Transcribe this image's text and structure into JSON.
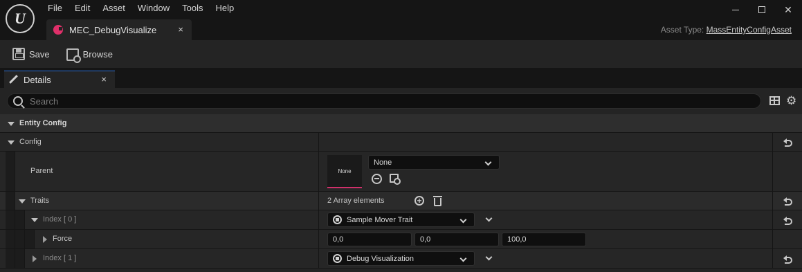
{
  "app": {
    "logo_letter": "U",
    "menu": [
      "File",
      "Edit",
      "Asset",
      "Window",
      "Tools",
      "Help"
    ],
    "window_close": "✕"
  },
  "document_tab": {
    "label": "MEC_DebugVisualize",
    "close": "×"
  },
  "asset_type": {
    "label": "Asset Type:",
    "value": "MassEntityConfigAsset"
  },
  "toolbar": {
    "save_label": "Save",
    "browse_label": "Browse"
  },
  "details_tab": {
    "label": "Details",
    "close": "×"
  },
  "search": {
    "placeholder": "Search"
  },
  "sections": {
    "entity_config": "Entity Config",
    "config": "Config"
  },
  "rows": {
    "parent": {
      "label": "Parent",
      "thumbnail_text": "None",
      "combo_value": "None"
    },
    "traits": {
      "label": "Traits",
      "array_summary": "2 Array elements"
    },
    "index0": {
      "label": "Index",
      "index_text": "[ 0 ]",
      "value": "Sample Mover Trait"
    },
    "force": {
      "label": "Force",
      "x": "0,0",
      "y": "0,0",
      "z": "100,0"
    },
    "index1": {
      "label": "Index",
      "index_text": "[ 1 ]",
      "value": "Debug Visualization"
    }
  },
  "colors": {
    "accent_tab": "#2a6fd6",
    "asset_dot": "#e0306a",
    "thumbnail_underline": "#d0306a"
  },
  "icons": [
    "unreal-logo-icon",
    "save-icon",
    "browse-icon",
    "pencil-icon",
    "search-icon",
    "grid-icon",
    "gear-icon",
    "reset-icon",
    "use-selected-icon",
    "browse-asset-icon",
    "add-element-icon",
    "trash-icon",
    "trait-icon",
    "chevron-down-icon"
  ]
}
